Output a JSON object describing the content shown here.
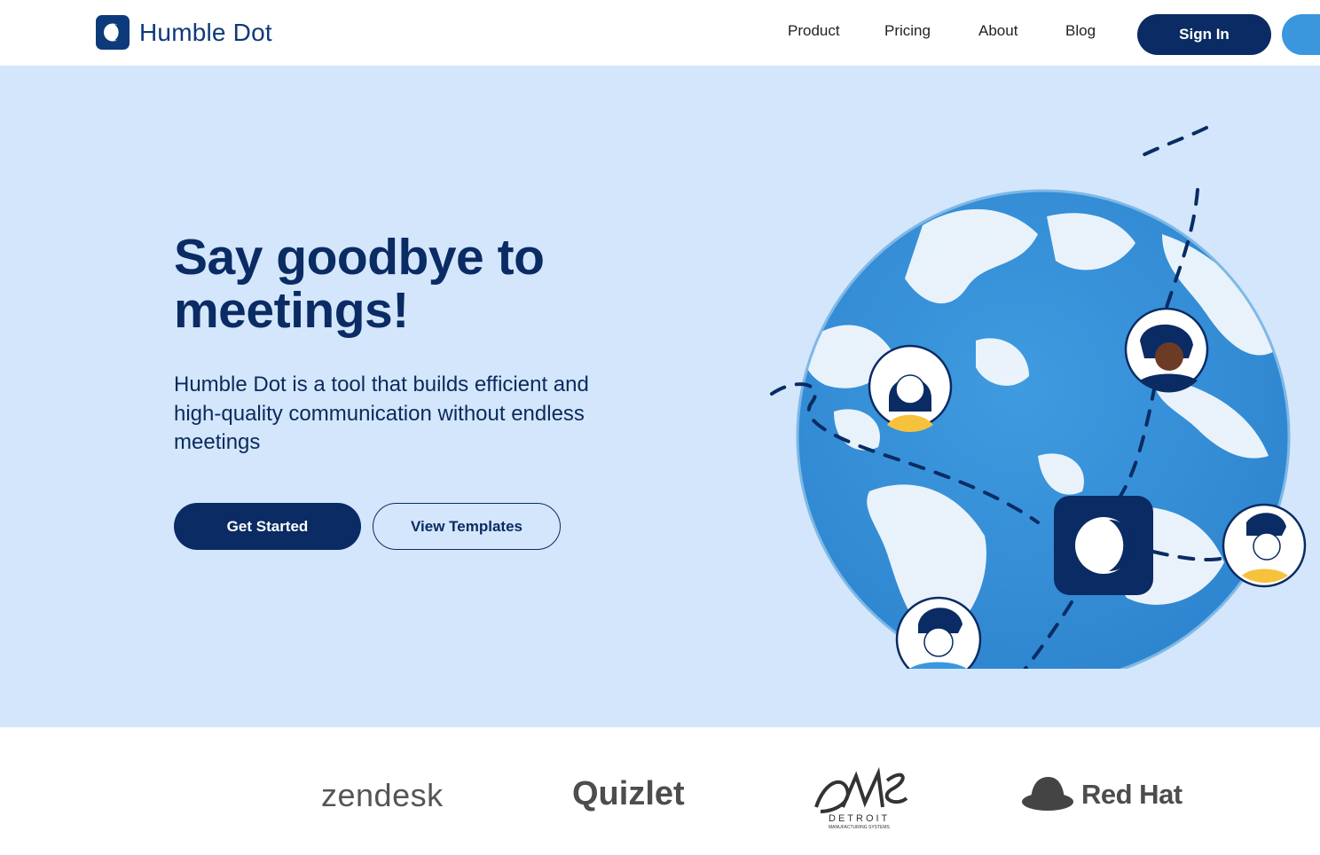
{
  "header": {
    "logo_text": "Humble Dot",
    "nav": [
      {
        "label": "Product"
      },
      {
        "label": "Pricing"
      },
      {
        "label": "About"
      },
      {
        "label": "Blog"
      }
    ],
    "signin_label": "Sign In"
  },
  "hero": {
    "headline": "Say goodbye to meetings!",
    "subtext": "Humble Dot is a tool that builds efficient and high-quality communication without endless meetings",
    "primary_cta": "Get Started",
    "secondary_cta": "View Templates"
  },
  "logos": {
    "brands": [
      {
        "name": "zendesk"
      },
      {
        "name": "Quizlet"
      },
      {
        "name": "DMS",
        "subtitle": "DETROIT",
        "tagline": "MANUFACTURING SYSTEMS"
      },
      {
        "name": "Red Hat"
      }
    ]
  },
  "colors": {
    "brand_navy": "#0a2b63",
    "hero_bg": "#d3e6fb",
    "accent_blue": "#3a97de"
  }
}
